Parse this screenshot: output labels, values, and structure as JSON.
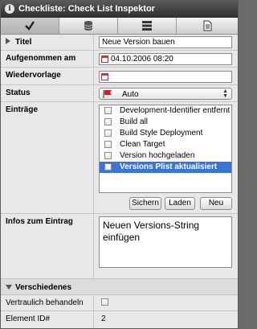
{
  "window": {
    "title": "Checkliste: Check List Inspektor",
    "info_icon_glyph": "i"
  },
  "tabs": [
    {
      "name": "checkmark-icon",
      "active": true
    },
    {
      "name": "database-icon",
      "active": false
    },
    {
      "name": "list-icon",
      "active": false
    },
    {
      "name": "document-icon",
      "active": false
    }
  ],
  "fields": {
    "titel_label": "Titel",
    "titel_value": "Neue Version bauen",
    "aufgenommen_label": "Aufgenommen am",
    "aufgenommen_value": "04.10.2006 08:20",
    "wiedervorlage_label": "Wiedervorlage",
    "wiedervorlage_value": "",
    "status_label": "Status",
    "status_value": "Auto",
    "eintraege_label": "Einträge"
  },
  "entries": [
    {
      "label": "Development-Identifier entfernt",
      "checked": false,
      "selected": false
    },
    {
      "label": "Build all",
      "checked": false,
      "selected": false
    },
    {
      "label": "Build Style Deployment",
      "checked": false,
      "selected": false
    },
    {
      "label": "Clean Target",
      "checked": false,
      "selected": false
    },
    {
      "label": "Version hochgeladen",
      "checked": false,
      "selected": false
    },
    {
      "label": "Versions Plist aktualisiert",
      "checked": false,
      "selected": true
    }
  ],
  "buttons": {
    "sichern": "Sichern",
    "laden": "Laden",
    "neu": "Neu"
  },
  "infos": {
    "label": "Infos zum Eintrag",
    "text": "Neuen Versions-String einfügen"
  },
  "verschiedenes": {
    "header": "Verschiedenes",
    "vertraulich_label": "Vertraulich behandeln",
    "vertraulich_checked": false,
    "element_id_label": "Element ID#",
    "element_id_value": "2"
  },
  "colors": {
    "selection": "#3875d7",
    "titlebar": "#2e2e2e",
    "flag": "#d81e1e"
  }
}
